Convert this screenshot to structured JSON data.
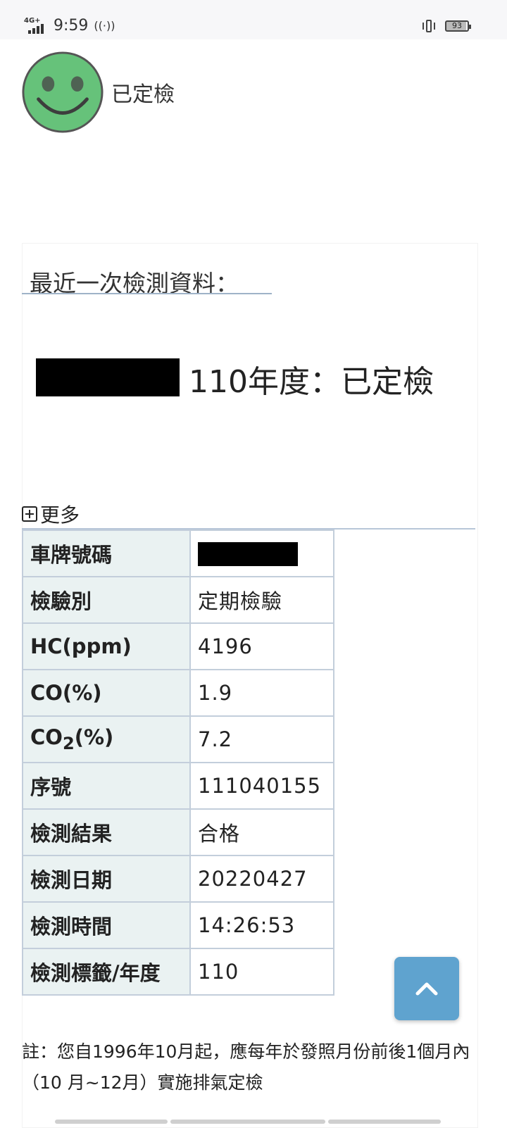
{
  "status_bar": {
    "network": "4G+",
    "time": "9:59",
    "battery": "93"
  },
  "header": {
    "status_text": "已定檢"
  },
  "section": {
    "title": "最近一次檢測資料：",
    "result_text": "110年度：已定檢",
    "more_label": "更多"
  },
  "details": {
    "rows": [
      {
        "label": "車牌號碼",
        "value": ""
      },
      {
        "label": "檢驗別",
        "value": "定期檢驗"
      },
      {
        "label": "HC(ppm)",
        "value": "4196"
      },
      {
        "label": "CO(%)",
        "value": "1.9"
      },
      {
        "label_prefix": "CO",
        "label_sub": "2",
        "label_suffix": "(%)",
        "value": "7.2"
      },
      {
        "label": "序號",
        "value": "111040155"
      },
      {
        "label": "檢測結果",
        "value": "合格"
      },
      {
        "label": "檢測日期",
        "value": "20220427"
      },
      {
        "label": "檢測時間",
        "value": "14:26:53"
      },
      {
        "label": "檢測標籤/年度",
        "value": "110"
      }
    ]
  },
  "note": {
    "text": "註：您自1996年10月起，應每年於發照月份前後1個月內（10 月~12月）實施排氣定檢"
  },
  "colors": {
    "smiley_face": "#66c27a",
    "table_label_bg": "#eaf2f2",
    "table_border": "#c3cedb",
    "scroll_button": "#5fa3cf"
  },
  "icons": {
    "status": "smiley-face-icon",
    "more": "plus-box-icon",
    "scroll_top": "chevron-up-icon"
  }
}
